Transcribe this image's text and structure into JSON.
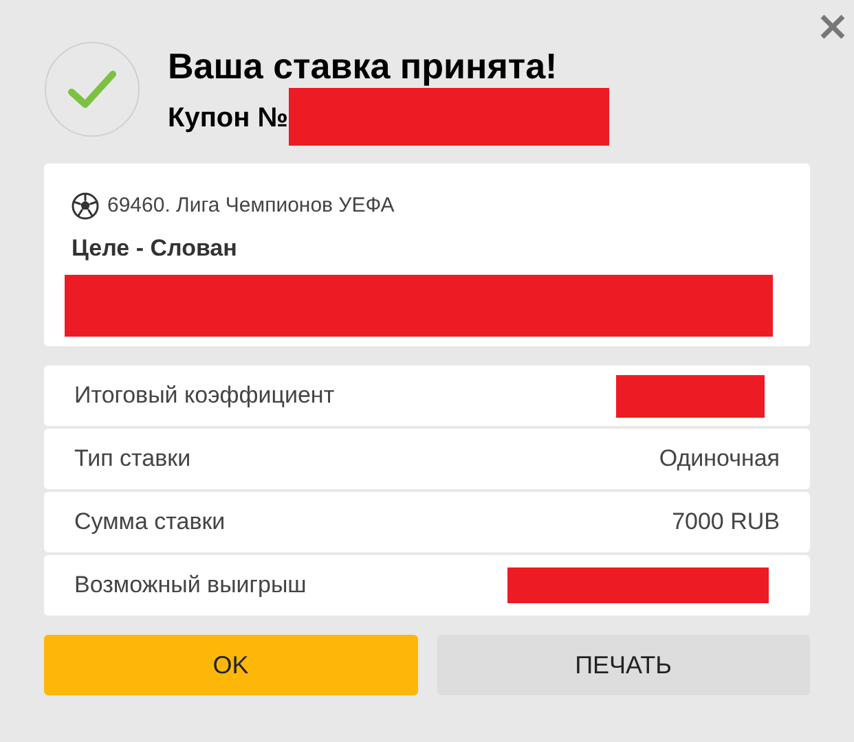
{
  "header": {
    "title": "Ваша ставка принята!",
    "coupon": {
      "label": "Купон №",
      "kind": "redacted"
    }
  },
  "event": {
    "league": "69460. Лига Чемпионов УЕФА",
    "match": "Целе - Слован",
    "outcome": {
      "kind": "redacted"
    }
  },
  "details": [
    {
      "label": "Итоговый коэффициент",
      "kind": "redacted"
    },
    {
      "label": "Тип ставки",
      "kind": "text",
      "value": "Одиночная"
    },
    {
      "label": "Сумма ставки",
      "kind": "text",
      "value": "7000 RUB"
    },
    {
      "label": "Возможный выигрыш",
      "kind": "redacted"
    }
  ],
  "buttons": [
    {
      "label": "OK",
      "kind": "primary"
    },
    {
      "label": "ПЕЧАТЬ",
      "kind": "secondary"
    }
  ]
}
